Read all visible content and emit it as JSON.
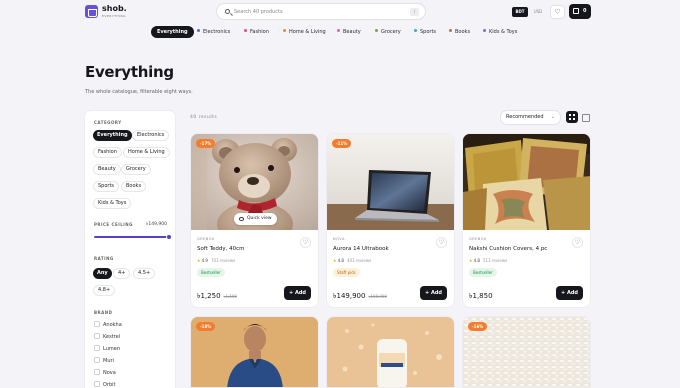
{
  "header": {
    "brand_name": "shob.",
    "brand_tagline": "EVERYTHING",
    "search_placeholder": "Search 40 products",
    "search_shortcut": "/",
    "currency_active": "BDT",
    "currency_other": "USD",
    "cart_count": "0"
  },
  "nav": {
    "categories": [
      {
        "label": "Everything",
        "active": true
      },
      {
        "label": "Electronics",
        "dot": "#4f6bd6"
      },
      {
        "label": "Fashion",
        "dot": "#e0527a"
      },
      {
        "label": "Home & Living",
        "dot": "#e48b2f"
      },
      {
        "label": "Beauty",
        "dot": "#d26bb0"
      },
      {
        "label": "Grocery",
        "dot": "#67b04a"
      },
      {
        "label": "Sports",
        "dot": "#3da9b8"
      },
      {
        "label": "Books",
        "dot": "#a8794f"
      },
      {
        "label": "Kids & Toys",
        "dot": "#8a65d8"
      }
    ]
  },
  "page": {
    "title": "Everything",
    "subtitle": "The whole catalogue, filterable eight ways."
  },
  "filters": {
    "category_heading": "CATEGORY",
    "category_chips": [
      "Everything",
      "Electronics",
      "Fashion",
      "Home & Living",
      "Beauty",
      "Grocery",
      "Sports",
      "Books",
      "Kids & Toys"
    ],
    "price_heading": "PRICE CEILING",
    "price_value": "৳149,900",
    "price_fraction": 1.0,
    "rating_heading": "RATING",
    "rating_chips": [
      "Any",
      "4+",
      "4.5+",
      "4.8+"
    ],
    "brand_heading": "BRAND",
    "brands": [
      "Anokha",
      "Kestrel",
      "Lumen",
      "Muri",
      "Nova",
      "Orbit"
    ]
  },
  "results": {
    "count_label": "40 results",
    "sort_label": "Recommended",
    "sort_icon": "chevron-down-icon"
  },
  "products": [
    {
      "discount": "-17%",
      "category": "GREBOX",
      "name": "Soft Teddy, 40cm",
      "rating": "4.9",
      "reviews": "703 reviews",
      "tag": "Bestseller",
      "tag_type": "best",
      "price": "৳1,250",
      "was": "৳1,500",
      "add_label": "Add",
      "quick_view": "Quick view"
    },
    {
      "discount": "-11%",
      "category": "NOVA",
      "name": "Aurora 14 Ultrabook",
      "rating": "4.8",
      "reviews": "403 reviews",
      "tag": "Staff pick",
      "tag_type": "staff",
      "price": "৳149,900",
      "was": "৳168,000",
      "add_label": "Add"
    },
    {
      "discount": "",
      "category": "GREBOX",
      "name": "Nakshi Cushion Covers, 4 pc",
      "rating": "4.8",
      "reviews": "513 reviews",
      "tag": "Bestseller",
      "tag_type": "best",
      "price": "৳1,850",
      "was": "",
      "add_label": "Add"
    },
    {
      "discount": "-18%"
    },
    {
      "discount": ""
    },
    {
      "discount": "-16%"
    }
  ]
}
